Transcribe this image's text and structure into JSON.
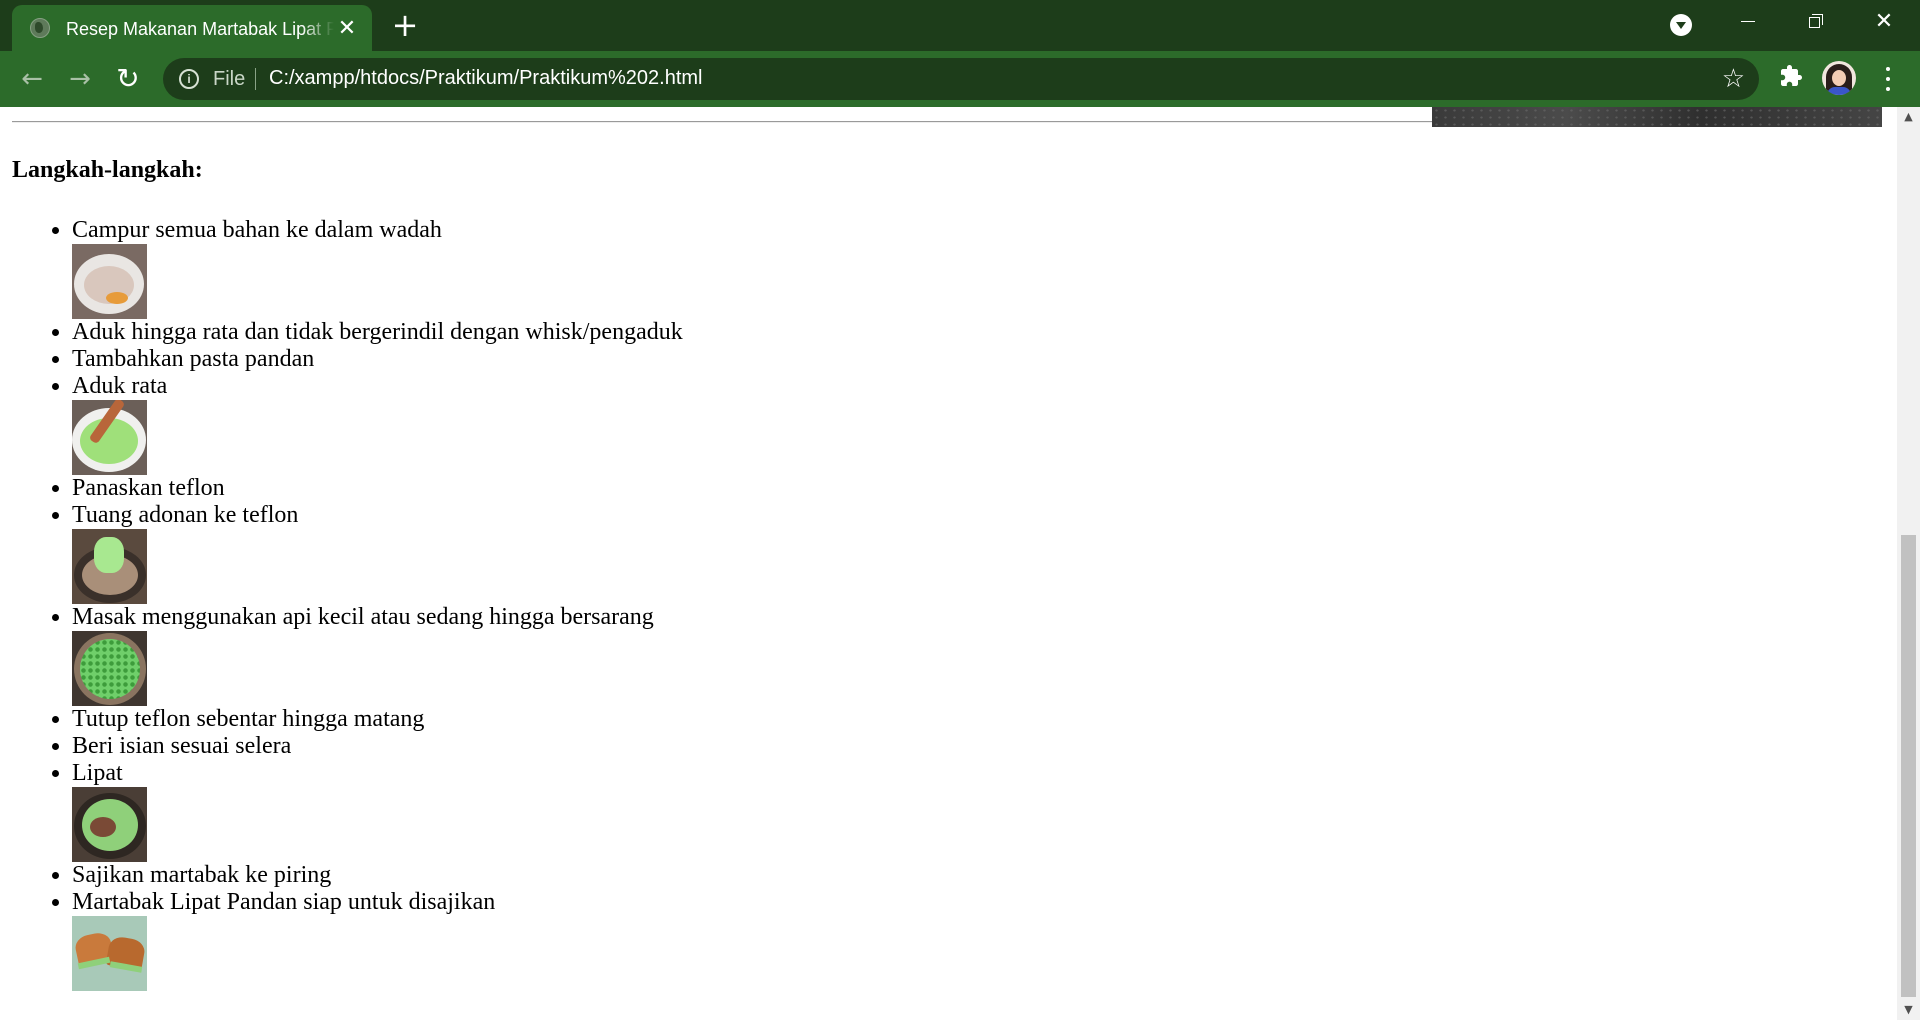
{
  "browser": {
    "tab_title": "Resep Makanan Martabak Lipat Pandan",
    "tab_close": "✕",
    "new_tab": "+",
    "url_scheme": "File",
    "url": "C:/xampp/htdocs/Praktikum/Praktikum%202.html",
    "nav_back": "←",
    "nav_forward": "→",
    "nav_reload": "↻",
    "star": "☆",
    "window_close": "✕"
  },
  "page": {
    "heading": "Langkah-langkah:",
    "steps": [
      {
        "text": "Campur semua bahan ke dalam wadah",
        "image": "bowl-dry-ingredients"
      },
      {
        "text": "Aduk hingga rata dan tidak bergerindil dengan whisk/pengaduk"
      },
      {
        "text": "Tambahkan pasta pandan"
      },
      {
        "text": "Aduk rata",
        "image": "green-batter-whisk"
      },
      {
        "text": "Panaskan teflon"
      },
      {
        "text": "Tuang adonan ke teflon",
        "image": "pouring-batter"
      },
      {
        "text": "Masak menggunakan api kecil atau sedang hingga bersarang",
        "image": "cooking-honeycomb"
      },
      {
        "text": "Tutup teflon sebentar hingga matang"
      },
      {
        "text": "Beri isian sesuai selera"
      },
      {
        "text": "Lipat",
        "image": "folding-martabak"
      },
      {
        "text": "Sajikan martabak ke piring"
      },
      {
        "text": "Martabak Lipat Pandan siap untuk disajikan",
        "image": "served-martabak"
      }
    ]
  },
  "colors": {
    "titlebar": "#1d3d1a",
    "toolbar": "#2c6b2a",
    "omnibox": "#1d3d1a"
  }
}
